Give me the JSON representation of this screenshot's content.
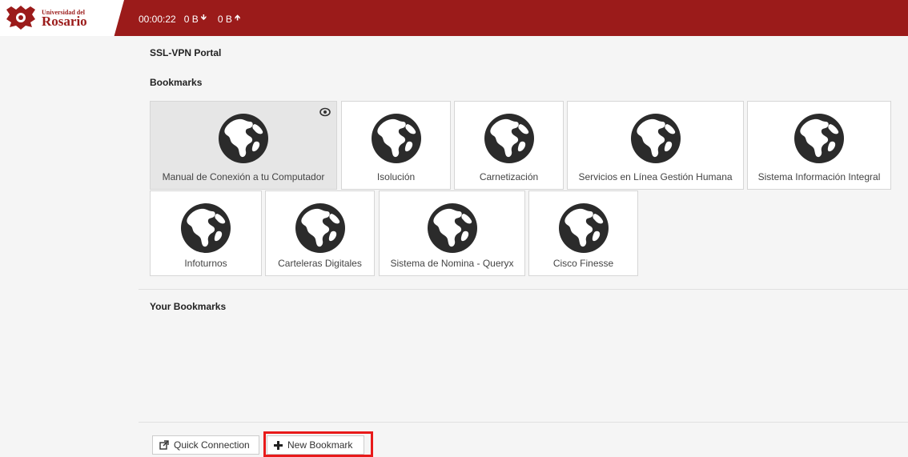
{
  "header": {
    "logo_small": "Universidad del",
    "logo_big": "Rosario",
    "elapsed": "00:00:22",
    "down": "0 B",
    "up": "0 B",
    "brand_color": "#9b1b1a"
  },
  "page": {
    "title": "SSL-VPN Portal",
    "bookmarks_heading": "Bookmarks",
    "your_bookmarks_heading": "Your Bookmarks"
  },
  "bookmarks": [
    {
      "label": "Manual de Conexión a tu Computador",
      "icon": "globe-icon",
      "active": true
    },
    {
      "label": "Isolución",
      "icon": "globe-icon"
    },
    {
      "label": "Carnetización",
      "icon": "globe-icon"
    },
    {
      "label": "Servicios en Línea Gestión Humana",
      "icon": "globe-icon"
    },
    {
      "label": "Sistema Información Integral",
      "icon": "globe-icon"
    },
    {
      "label": "Infoturnos",
      "icon": "globe-icon"
    },
    {
      "label": "Carteleras Digitales",
      "icon": "globe-icon"
    },
    {
      "label": "Sistema de Nomina - Queryx",
      "icon": "globe-icon"
    },
    {
      "label": "Cisco Finesse",
      "icon": "globe-icon"
    }
  ],
  "actions": {
    "quick_connection": "Quick Connection",
    "new_bookmark": "New Bookmark"
  }
}
